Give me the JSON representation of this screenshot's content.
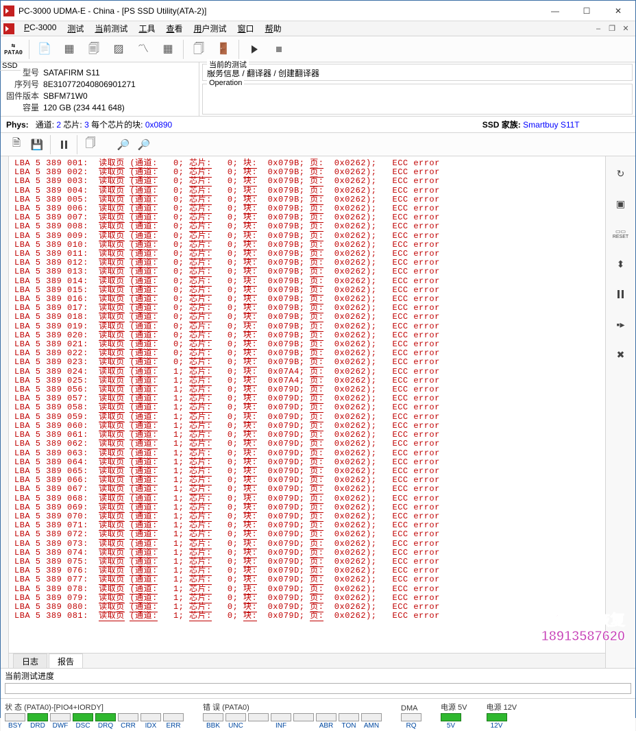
{
  "titlebar": {
    "title": "PC-3000 UDMA-E - China - [PS SSD Utility(ATA-2)]"
  },
  "menu": {
    "items": [
      "PC-3000",
      "测试",
      "当前测试",
      "工具",
      "查看",
      "用户测试",
      "窗口",
      "帮助"
    ]
  },
  "toolbar": {
    "patao_top": "⇆",
    "patao_bottom": "PATA0"
  },
  "device": {
    "tab": "SSD",
    "labels": {
      "model": "型号",
      "serial": "序列号",
      "fw": "固件版本",
      "cap": "容量"
    },
    "model": "SATAFIRM   S11",
    "serial": "8E310772040806901271",
    "fw": "SBFM71W0",
    "cap": "120 GB (234 441 648)"
  },
  "right_panel": {
    "current_test_label": "当前的测试",
    "current_test_value": "服务信息 / 翻译器 / 创建翻译器",
    "operation_label": "Operation"
  },
  "phys": {
    "prefix": "Phys:",
    "chan_label": "通道:",
    "chan": "2",
    "chip_label": "芯片:",
    "chip": "3",
    "blocks_label": "每个芯片的块:",
    "blocks": "0x0890",
    "family_label": "SSD 家族:",
    "family": "Smartbuy S11T"
  },
  "log": {
    "rows": [
      {
        "idx": "001",
        "ch": "0",
        "blk": "0x079B"
      },
      {
        "idx": "002",
        "ch": "0",
        "blk": "0x079B"
      },
      {
        "idx": "003",
        "ch": "0",
        "blk": "0x079B"
      },
      {
        "idx": "004",
        "ch": "0",
        "blk": "0x079B"
      },
      {
        "idx": "005",
        "ch": "0",
        "blk": "0x079B"
      },
      {
        "idx": "006",
        "ch": "0",
        "blk": "0x079B"
      },
      {
        "idx": "007",
        "ch": "0",
        "blk": "0x079B"
      },
      {
        "idx": "008",
        "ch": "0",
        "blk": "0x079B"
      },
      {
        "idx": "009",
        "ch": "0",
        "blk": "0x079B"
      },
      {
        "idx": "010",
        "ch": "0",
        "blk": "0x079B"
      },
      {
        "idx": "011",
        "ch": "0",
        "blk": "0x079B"
      },
      {
        "idx": "012",
        "ch": "0",
        "blk": "0x079B"
      },
      {
        "idx": "013",
        "ch": "0",
        "blk": "0x079B"
      },
      {
        "idx": "014",
        "ch": "0",
        "blk": "0x079B"
      },
      {
        "idx": "015",
        "ch": "0",
        "blk": "0x079B"
      },
      {
        "idx": "016",
        "ch": "0",
        "blk": "0x079B"
      },
      {
        "idx": "017",
        "ch": "0",
        "blk": "0x079B"
      },
      {
        "idx": "018",
        "ch": "0",
        "blk": "0x079B"
      },
      {
        "idx": "019",
        "ch": "0",
        "blk": "0x079B"
      },
      {
        "idx": "020",
        "ch": "0",
        "blk": "0x079B"
      },
      {
        "idx": "021",
        "ch": "0",
        "blk": "0x079B"
      },
      {
        "idx": "022",
        "ch": "0",
        "blk": "0x079B"
      },
      {
        "idx": "023",
        "ch": "0",
        "blk": "0x079B"
      },
      {
        "idx": "024",
        "ch": "1",
        "blk": "0x07A4"
      },
      {
        "idx": "025",
        "ch": "1",
        "blk": "0x07A4"
      },
      {
        "idx": "056",
        "ch": "1",
        "blk": "0x079D"
      },
      {
        "idx": "057",
        "ch": "1",
        "blk": "0x079D"
      },
      {
        "idx": "058",
        "ch": "1",
        "blk": "0x079D"
      },
      {
        "idx": "059",
        "ch": "1",
        "blk": "0x079D"
      },
      {
        "idx": "060",
        "ch": "1",
        "blk": "0x079D"
      },
      {
        "idx": "061",
        "ch": "1",
        "blk": "0x079D"
      },
      {
        "idx": "062",
        "ch": "1",
        "blk": "0x079D"
      },
      {
        "idx": "063",
        "ch": "1",
        "blk": "0x079D"
      },
      {
        "idx": "064",
        "ch": "1",
        "blk": "0x079D"
      },
      {
        "idx": "065",
        "ch": "1",
        "blk": "0x079D"
      },
      {
        "idx": "066",
        "ch": "1",
        "blk": "0x079D"
      },
      {
        "idx": "067",
        "ch": "1",
        "blk": "0x079D"
      },
      {
        "idx": "068",
        "ch": "1",
        "blk": "0x079D"
      },
      {
        "idx": "069",
        "ch": "1",
        "blk": "0x079D"
      },
      {
        "idx": "070",
        "ch": "1",
        "blk": "0x079D"
      },
      {
        "idx": "071",
        "ch": "1",
        "blk": "0x079D"
      },
      {
        "idx": "072",
        "ch": "1",
        "blk": "0x079D"
      },
      {
        "idx": "073",
        "ch": "1",
        "blk": "0x079D"
      },
      {
        "idx": "074",
        "ch": "1",
        "blk": "0x079D"
      },
      {
        "idx": "075",
        "ch": "1",
        "blk": "0x079D"
      },
      {
        "idx": "076",
        "ch": "1",
        "blk": "0x079D"
      },
      {
        "idx": "077",
        "ch": "1",
        "blk": "0x079D"
      },
      {
        "idx": "078",
        "ch": "1",
        "blk": "0x079D"
      },
      {
        "idx": "079",
        "ch": "1",
        "blk": "0x079D"
      },
      {
        "idx": "080",
        "ch": "1",
        "blk": "0x079D"
      },
      {
        "idx": "081",
        "ch": "1",
        "blk": "0x079D"
      }
    ],
    "constants": {
      "lba_prefix": "LBA 5 389 ",
      "read": "读取页",
      "chan": "(通道:",
      "chip": "芯片:",
      "chip_v": "0",
      "blk": "块:",
      "page": "页:",
      "page_v": "0x0262);",
      "ecc": "ECC error"
    }
  },
  "tabs": {
    "log": "日志",
    "report": "报告"
  },
  "progress": {
    "label": "当前测试进度"
  },
  "status": {
    "state_label": "状 态 (PATA0)-[PIO4+IORDY]",
    "error_label": "错 误 (PATA0)",
    "dma_label": "DMA",
    "p5_label": "电源 5V",
    "p5": "5V",
    "p12_label": "电源 12V",
    "p12": "12V",
    "state_leds": [
      "BSY",
      "DRD",
      "DWF",
      "DSC",
      "DRQ",
      "CRR",
      "IDX",
      "ERR"
    ],
    "state_on": [
      false,
      true,
      false,
      true,
      true,
      false,
      false,
      false
    ],
    "error_leds": [
      "BBK",
      "UNC",
      "",
      "INF",
      "",
      "ABR",
      "TON",
      "AMN"
    ],
    "dma_leds": [
      "RQ"
    ]
  },
  "watermark": {
    "line1": "盘首数据恢复",
    "line2": "18913587620"
  }
}
